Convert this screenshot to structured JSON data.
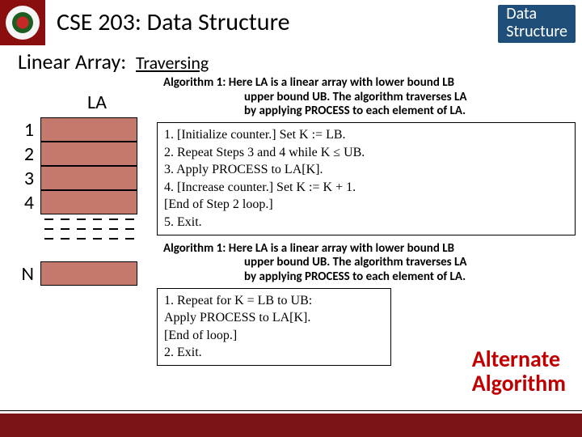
{
  "header": {
    "course": "CSE 203: Data Structure",
    "badge_line1": "Data",
    "badge_line2": "Structure"
  },
  "section": {
    "label": "Linear Array:",
    "subtopic": "Traversing"
  },
  "array": {
    "label": "LA",
    "indices": [
      "1",
      "2",
      "3",
      "4"
    ],
    "last_index": "N"
  },
  "algo1": {
    "heading_l1": "Algorithm 1: Here LA is a linear array with lower bound LB",
    "heading_l2": "upper bound UB. The algorithm traverses LA",
    "heading_l3": "by applying PROCESS to each element of LA.",
    "steps": [
      "1.   [Initialize counter.] Set K := LB.",
      "2.   Repeat Steps 3 and 4 while K ≤ UB.",
      "3.       Apply PROCESS to LA[K].",
      "4.       [Increase counter.] Set K := K + 1.",
      "      [End of Step 2 loop.]",
      "5.   Exit."
    ]
  },
  "algo2": {
    "heading_l1": "Algorithm 1: Here LA is a linear array with lower bound LB",
    "heading_l2": "upper bound UB. The algorithm traverses LA",
    "heading_l3": "by applying PROCESS to each element of LA.",
    "steps": [
      "1.   Repeat for K = LB to UB:",
      "          Apply PROCESS to LA[K].",
      "      [End of loop.]",
      "2.   Exit."
    ],
    "alt_l1": "Alternate",
    "alt_l2": "Algorithm"
  }
}
